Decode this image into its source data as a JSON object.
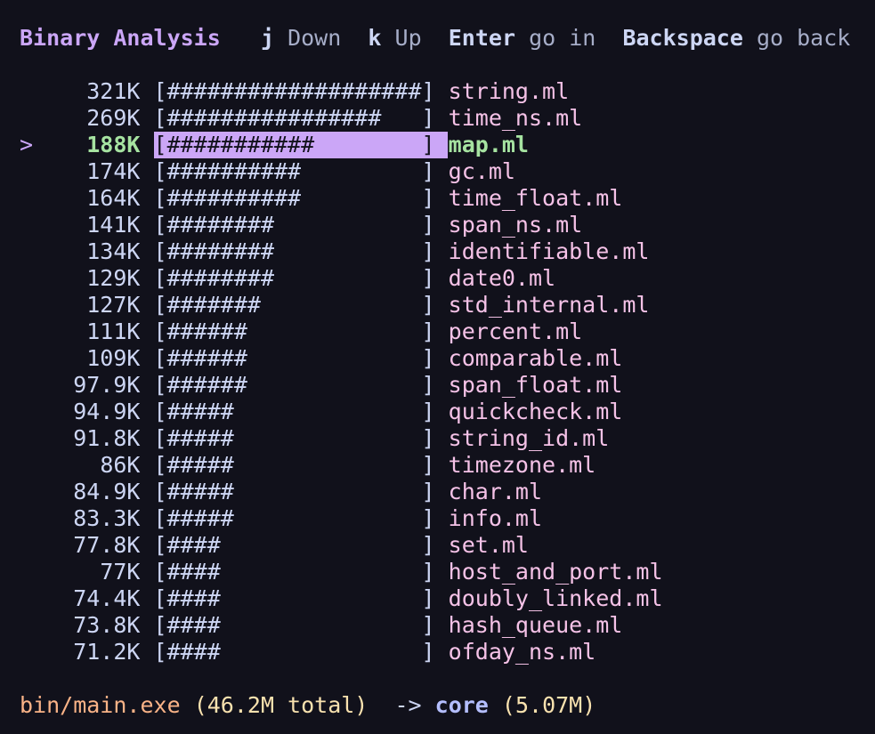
{
  "header": {
    "title": "Binary Analysis",
    "keys": [
      {
        "key": "j",
        "action": "Down"
      },
      {
        "key": "k",
        "action": "Up"
      },
      {
        "key": "Enter",
        "action": "go in"
      },
      {
        "key": "Backspace",
        "action": "go back"
      }
    ]
  },
  "selected_index": 2,
  "pointer_glyph": ">",
  "rows": [
    {
      "size": "321K",
      "bar": "[###################]",
      "name": "string.ml"
    },
    {
      "size": "269K",
      "bar": "[################   ]",
      "name": "time_ns.ml"
    },
    {
      "size": "188K",
      "bar": "[###########        ]",
      "name": "map.ml"
    },
    {
      "size": "174K",
      "bar": "[##########         ]",
      "name": "gc.ml"
    },
    {
      "size": "164K",
      "bar": "[##########         ]",
      "name": "time_float.ml"
    },
    {
      "size": "141K",
      "bar": "[########           ]",
      "name": "span_ns.ml"
    },
    {
      "size": "134K",
      "bar": "[########           ]",
      "name": "identifiable.ml"
    },
    {
      "size": "129K",
      "bar": "[########           ]",
      "name": "date0.ml"
    },
    {
      "size": "127K",
      "bar": "[#######            ]",
      "name": "std_internal.ml"
    },
    {
      "size": "111K",
      "bar": "[######             ]",
      "name": "percent.ml"
    },
    {
      "size": "109K",
      "bar": "[######             ]",
      "name": "comparable.ml"
    },
    {
      "size": "97.9K",
      "bar": "[######             ]",
      "name": "span_float.ml"
    },
    {
      "size": "94.9K",
      "bar": "[#####              ]",
      "name": "quickcheck.ml"
    },
    {
      "size": "91.8K",
      "bar": "[#####              ]",
      "name": "string_id.ml"
    },
    {
      "size": "86K",
      "bar": "[#####              ]",
      "name": "timezone.ml"
    },
    {
      "size": "84.9K",
      "bar": "[#####              ]",
      "name": "char.ml"
    },
    {
      "size": "83.3K",
      "bar": "[#####              ]",
      "name": "info.ml"
    },
    {
      "size": "77.8K",
      "bar": "[####               ]",
      "name": "set.ml"
    },
    {
      "size": "77K",
      "bar": "[####               ]",
      "name": "host_and_port.ml"
    },
    {
      "size": "74.4K",
      "bar": "[####               ]",
      "name": "doubly_linked.ml"
    },
    {
      "size": "73.8K",
      "bar": "[####               ]",
      "name": "hash_queue.ml"
    },
    {
      "size": "71.2K",
      "bar": "[####               ]",
      "name": "ofday_ns.ml"
    }
  ],
  "footer": {
    "path": "bin/main.exe",
    "total": "(46.2M total)",
    "arrow": "->",
    "current": "core",
    "current_size": "(5.07M)"
  },
  "colors": {
    "background": "#11111b",
    "title": "#cba6f7",
    "selection_bar": "#cba6f7",
    "selected_text": "#a6e3a1",
    "file_name": "#f5c2e7",
    "footer_path": "#fab387",
    "footer_size": "#f9e2af",
    "footer_current": "#b4befe"
  }
}
